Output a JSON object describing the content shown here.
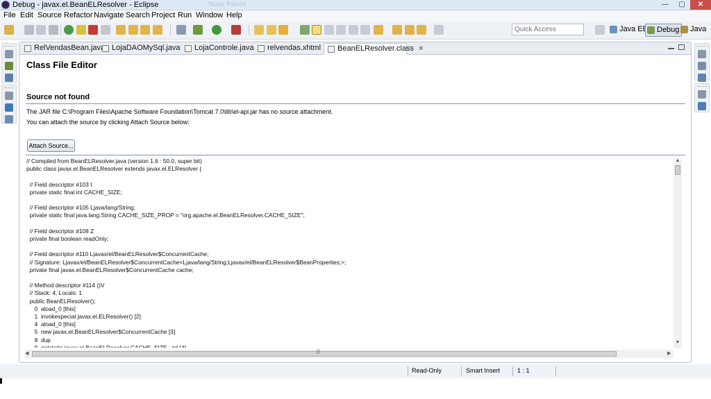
{
  "window": {
    "title": "Debug - javax.el.BeanELResolver - Eclipse",
    "background_title": "Novo Painel",
    "controls": {
      "minimize": "—",
      "maximize": "▢",
      "close": "✕"
    }
  },
  "menu": [
    "File",
    "Edit",
    "Source",
    "Refactor",
    "Navigate",
    "Search",
    "Project",
    "Run",
    "Window",
    "Help"
  ],
  "toolbar": {
    "quick_access_placeholder": "Quick Access",
    "perspectives": [
      {
        "label": "Java EE",
        "icon": "java-ee-perspective-icon",
        "active": false
      },
      {
        "label": "Debug",
        "icon": "debug-perspective-icon",
        "active": true
      },
      {
        "label": "Java",
        "icon": "java-perspective-icon",
        "active": false
      }
    ]
  },
  "editor": {
    "tabs": [
      {
        "label": "RelVendasBean.java",
        "active": false
      },
      {
        "label": "LojaDAOMySql.java",
        "active": false
      },
      {
        "label": "LojaControle.java",
        "active": false
      },
      {
        "label": "relvendas.xhtml",
        "active": false
      },
      {
        "label": "BeanELResolver.class",
        "active": true
      }
    ],
    "tab_close": "✕",
    "heading": "Class File Editor",
    "section_title": "Source not found",
    "jar_message": "The JAR file C:\\Program Files\\Apache Software Foundation\\Tomcat 7.0\\lib\\el-api.jar has no source attachment.",
    "attach_message": "You can attach the source by clicking Attach Source below:",
    "attach_button": "Attach Source...",
    "code": "// Compiled from BeanELResolver.java (version 1.6 : 50.0, super bit)\npublic class javax.el.BeanELResolver extends javax.el.ELResolver {\n\n  // Field descriptor #103 I\n  private static final int CACHE_SIZE;\n\n  // Field descriptor #105 Ljava/lang/String;\n  private static final java.lang.String CACHE_SIZE_PROP = \"org.apache.el.BeanELResolver.CACHE_SIZE\";\n\n  // Field descriptor #108 Z\n  private final boolean readOnly;\n\n  // Field descriptor #110 Ljavax/el/BeanELResolver$ConcurrentCache;\n  // Signature: Ljavax/el/BeanELResolver$ConcurrentCache<Ljava/lang/String;Ljavax/el/BeanELResolver$BeanProperties;>;\n  private final javax.el.BeanELResolver$ConcurrentCache cache;\n\n  // Method descriptor #114 ()V\n  // Stack: 4, Locals: 1\n  public BeanELResolver();\n     0  aload_0 [this]\n     1  invokespecial javax.el.ELResolver() [2]\n     4  aload_0 [this]\n     5  new javax.el.BeanELResolver$ConcurrentCache [3]\n     8  dup\n     9  getstatic javax.el.BeanELResolver.CACHE_SIZE : int [4]"
  },
  "statusbar": {
    "access": "Read-Only",
    "insert_mode": "Smart Insert",
    "position": "1 : 1"
  }
}
